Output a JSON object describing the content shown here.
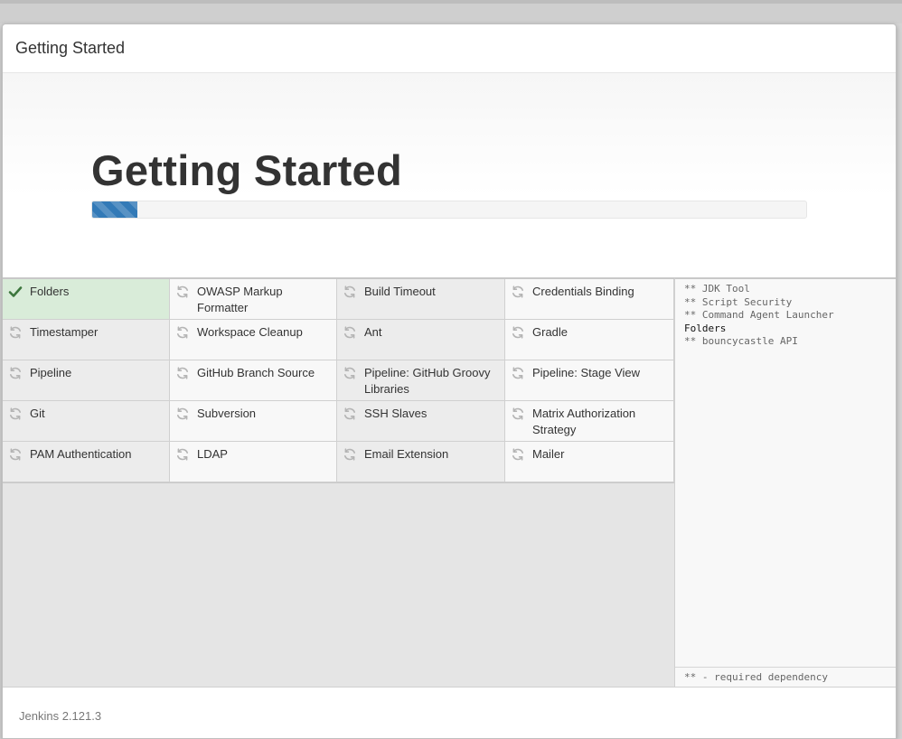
{
  "dialog": {
    "title": "Getting Started"
  },
  "hero": {
    "title": "Getting Started",
    "progress_fraction": 0.063
  },
  "colors": {
    "accent": "#337ab7",
    "success": "#3c763d",
    "pending_icon": "#b5b5b5"
  },
  "plugins": [
    {
      "name": "Folders",
      "status": "installed",
      "icon": "check-icon"
    },
    {
      "name": "OWASP Markup Formatter",
      "status": "pending",
      "icon": "refresh-icon"
    },
    {
      "name": "Build Timeout",
      "status": "pending",
      "icon": "refresh-icon"
    },
    {
      "name": "Credentials Binding",
      "status": "pending",
      "icon": "refresh-icon"
    },
    {
      "name": "Timestamper",
      "status": "pending",
      "icon": "refresh-icon"
    },
    {
      "name": "Workspace Cleanup",
      "status": "pending",
      "icon": "refresh-icon"
    },
    {
      "name": "Ant",
      "status": "pending",
      "icon": "refresh-icon"
    },
    {
      "name": "Gradle",
      "status": "pending",
      "icon": "refresh-icon"
    },
    {
      "name": "Pipeline",
      "status": "pending",
      "icon": "refresh-icon"
    },
    {
      "name": "GitHub Branch Source",
      "status": "pending",
      "icon": "refresh-icon"
    },
    {
      "name": "Pipeline: GitHub Groovy Libraries",
      "status": "pending",
      "icon": "refresh-icon"
    },
    {
      "name": "Pipeline: Stage View",
      "status": "pending",
      "icon": "refresh-icon"
    },
    {
      "name": "Git",
      "status": "pending",
      "icon": "refresh-icon"
    },
    {
      "name": "Subversion",
      "status": "pending",
      "icon": "refresh-icon"
    },
    {
      "name": "SSH Slaves",
      "status": "pending",
      "icon": "refresh-icon"
    },
    {
      "name": "Matrix Authorization Strategy",
      "status": "pending",
      "icon": "refresh-icon"
    },
    {
      "name": "PAM Authentication",
      "status": "pending",
      "icon": "refresh-icon"
    },
    {
      "name": "LDAP",
      "status": "pending",
      "icon": "refresh-icon"
    },
    {
      "name": "Email Extension",
      "status": "pending",
      "icon": "refresh-icon"
    },
    {
      "name": "Mailer",
      "status": "pending",
      "icon": "refresh-icon"
    }
  ],
  "log": {
    "lines": [
      {
        "text": "** JDK Tool",
        "installed": false
      },
      {
        "text": "** Script Security",
        "installed": false
      },
      {
        "text": "** Command Agent Launcher",
        "installed": false
      },
      {
        "text": "Folders",
        "installed": true
      },
      {
        "text": "** bouncycastle API",
        "installed": false
      }
    ],
    "footer": "** - required dependency"
  },
  "footer": {
    "version": "Jenkins 2.121.3"
  }
}
